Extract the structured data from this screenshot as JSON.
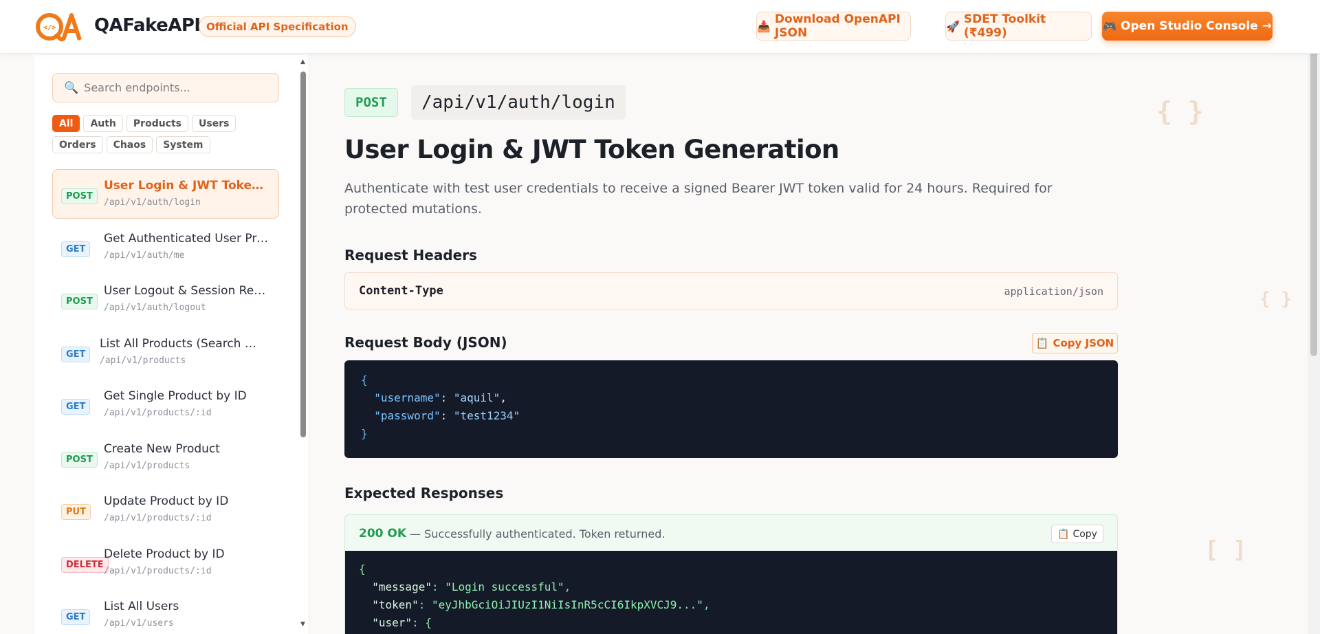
{
  "header": {
    "brand": "QAFakeAPI",
    "badge": "Official API Specification",
    "download_label": "Download OpenAPI JSON",
    "toolkit_label": "SDET Toolkit (₹499)",
    "studio_label": "Open Studio Console →",
    "download_icon": "download-icon",
    "toolkit_icon": "rocket-icon",
    "studio_icon": "gamepad-icon"
  },
  "sidebar": {
    "search_placeholder": "Search endpoints...",
    "filters": [
      "All",
      "Auth",
      "Products",
      "Users",
      "Orders",
      "Chaos",
      "System"
    ],
    "active_filter": "All",
    "endpoints": [
      {
        "method": "POST",
        "title": "User Login & JWT Token Generation",
        "path": "/api/v1/auth/login"
      },
      {
        "method": "GET",
        "title": "Get Authenticated User Profile",
        "path": "/api/v1/auth/me"
      },
      {
        "method": "POST",
        "title": "User Logout & Session Revocation",
        "path": "/api/v1/auth/logout"
      },
      {
        "method": "GET",
        "title": "List All Products (Search & Pagination)",
        "path": "/api/v1/products"
      },
      {
        "method": "GET",
        "title": "Get Single Product by ID",
        "path": "/api/v1/products/:id"
      },
      {
        "method": "POST",
        "title": "Create New Product",
        "path": "/api/v1/products"
      },
      {
        "method": "PUT",
        "title": "Update Product by ID",
        "path": "/api/v1/products/:id"
      },
      {
        "method": "DELETE",
        "title": "Delete Product by ID",
        "path": "/api/v1/products/:id"
      },
      {
        "method": "GET",
        "title": "List All Users",
        "path": "/api/v1/users"
      }
    ]
  },
  "main": {
    "method": "POST",
    "path": "/api/v1/auth/login",
    "title": "User Login & JWT Token Generation",
    "description": "Authenticate with test user credentials to receive a signed Bearer JWT token valid for 24 hours. Required for protected mutations.",
    "headers_title": "Request Headers",
    "header_key": "Content-Type",
    "header_value": "application/json",
    "body_title": "Request Body (JSON)",
    "copy_json_label": "Copy JSON",
    "body_json": {
      "username": "aquil",
      "password": "test1234"
    },
    "responses_title": "Expected Responses",
    "response": {
      "status": "200 OK",
      "note": "— Successfully authenticated. Token returned.",
      "copy_label": "Copy",
      "message": "Login successful",
      "token": "eyJhbGciOiJIUzI1NiIsInR5cCI6IkpXVCJ9..."
    }
  },
  "colors": {
    "accent": "#ee5b12",
    "post": "#1e9a4d",
    "get": "#2b7bc4",
    "put": "#e07a15",
    "delete": "#d22d3a"
  }
}
